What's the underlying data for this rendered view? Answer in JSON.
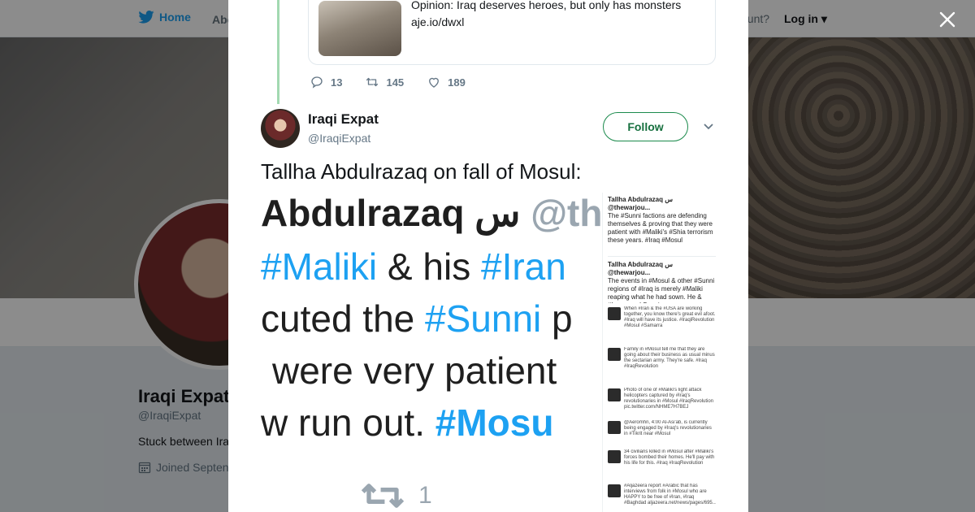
{
  "background_page": {
    "nav": {
      "home": "Home",
      "about": "Abo",
      "account": "count?",
      "login": "Log in"
    },
    "profile": {
      "name": "Iraqi Expat",
      "handle": "@IraqiExpat",
      "bio": "Stuck between Ira",
      "joined": "Joined Septen"
    }
  },
  "modal": {
    "quoted_card": {
      "title": "Opinion: Iraq deserves heroes, but only has monsters",
      "link": "aje.io/dwxl"
    },
    "prev_actions": {
      "replies": "13",
      "retweets": "145",
      "likes": "189"
    },
    "author": {
      "name": "Iraqi Expat",
      "handle": "@IraqiExpat"
    },
    "follow_label": "Follow",
    "tweet_text": "Tallha Abdulrazaq on fall of Mosul:",
    "image": {
      "big_lines": [
        {
          "pre": "Abdulrazaq س ",
          "tag": "@th",
          "post": ""
        },
        {
          "pre": "",
          "tag": "#Maliki",
          "post": " & his ",
          "tag2": "#Iran"
        },
        {
          "pre": "cuted the ",
          "tag": "#Sunni",
          "post": " p"
        },
        {
          "pre": "were very patient",
          "tag": "",
          "post": ""
        },
        {
          "pre": "w run out. ",
          "tag": "#Mosu",
          "post": ""
        }
      ],
      "big_retweet_count": "1",
      "side_tweets": [
        {
          "header": "Tallha Abdulrazaq س @thewarjou...",
          "body": "The #Sunni factions are defending themselves & proving that they were patient with #Maliki's #Shia terrorism these years. #Iraq #Mosul"
        },
        {
          "header": "Tallha Abdulrazaq س @thewarjou...",
          "body": "The events in #Mosul & other #Sunni regions of #Iraq is merely #Maliki reaping what he had sown. He & #Iran raped Sunnis"
        }
      ],
      "small_tweets": [
        "When #Iran & the #USA are working together, you know there's great evil afoot. #Iraq will have its justice. #IraqiRevolution #Mosul #Samarra",
        "Family in #Mosul tell me that they are going about their business as usual minus the sectarian army. They're safe. #Iraq #IraqRevolution",
        "Photo of one of #Maliki's light attack helicopters captured by #Iraq's revolutionaries in #Mosul #IraqRevolution pic.twitter.com/NHME7H7BEJ",
        "@Aeromhn, 4:00 Al-Asi'ab, is currently being engaged by #Iraq's revolutionaries in #Tikrit near #Mosul",
        "34 civilians killed in #Mosul after #Maliki's forces bombed their homes. He'll pay with his life for this. #Iraq #IraqRevolution",
        "#Aljazeera report #Arabic that has interviews from folk in #Mosul who are HAPPY to be free of #Iran, #Iraq #Baghdad aljazeera.net/news/pages/695..."
      ]
    }
  }
}
